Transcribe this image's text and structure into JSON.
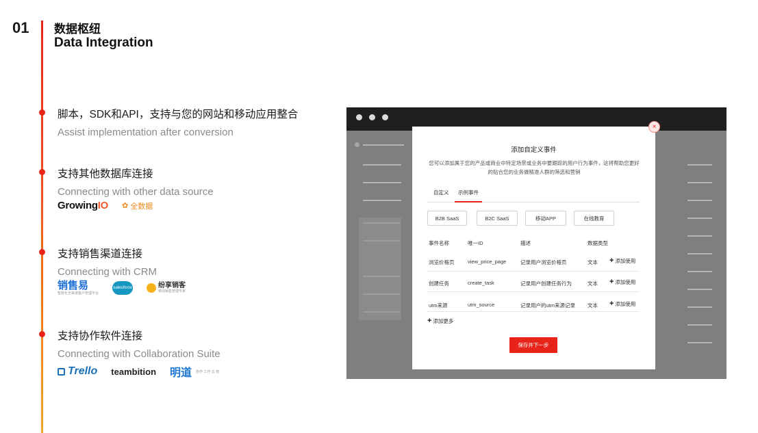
{
  "section": {
    "number": "01",
    "title_cn": "数据枢纽",
    "title_en": "Data Integration"
  },
  "features": [
    {
      "title_cn": "脚本，SDK和API，支持与您的网站和移动应用整合",
      "title_en": "Assist implementation after conversion"
    },
    {
      "title_cn": "支持其他数据库连接",
      "title_en": "Connecting with other data source"
    },
    {
      "title_cn": "支持销售渠道连接",
      "title_en": "Connecting with CRM"
    },
    {
      "title_cn": "支持协作软件连接",
      "title_en": "Connecting with Collaboration Suite"
    }
  ],
  "logos": {
    "growingio_a": "Growing",
    "growingio_b": "IO",
    "quanshuju": "全数据",
    "xiaoshouyi": "销售易",
    "xiaoshouyi_sub": "智能化全渠道客户管理平台",
    "salesforce": "salesforce",
    "fenxiang": "纷享销客",
    "fenxiang_sub": "移动销售管理专家",
    "trello": "Trello",
    "teambition": "teambition",
    "mingdao": "明道",
    "mingdao_sub": "协作 工作 云 管"
  },
  "modal": {
    "title": "添加自定义事件",
    "description": "您可以添加属于您的产品或商业中特定场景或业务中要跟踪的用户行为事件，这将帮助您更好的贴合您的业务做精准人群的筛选和营销",
    "tabs": [
      "自定义",
      "示例事件"
    ],
    "presets": [
      "B2B SaaS",
      "B2C SaaS",
      "移动APP",
      "在线教育"
    ],
    "columns": [
      "事件名称",
      "唯一ID",
      "描述",
      "数据类型"
    ],
    "rows": [
      {
        "name": "浏览价格页",
        "id": "view_price_page",
        "desc": "记录用户浏览价格页",
        "type": "文本",
        "action": "添加使用"
      },
      {
        "name": "创建任务",
        "id": "create_task",
        "desc": "记录用户创建任务行为",
        "type": "文本",
        "action": "添加使用"
      },
      {
        "name": "utm来源",
        "id": "utm_source",
        "desc": "记录用户的utm来源记录",
        "type": "文本",
        "action": "添加使用"
      }
    ],
    "add_more": "添加更多",
    "submit": "保存并下一步",
    "close": "×"
  },
  "colors": {
    "accent": "#e8241a"
  }
}
